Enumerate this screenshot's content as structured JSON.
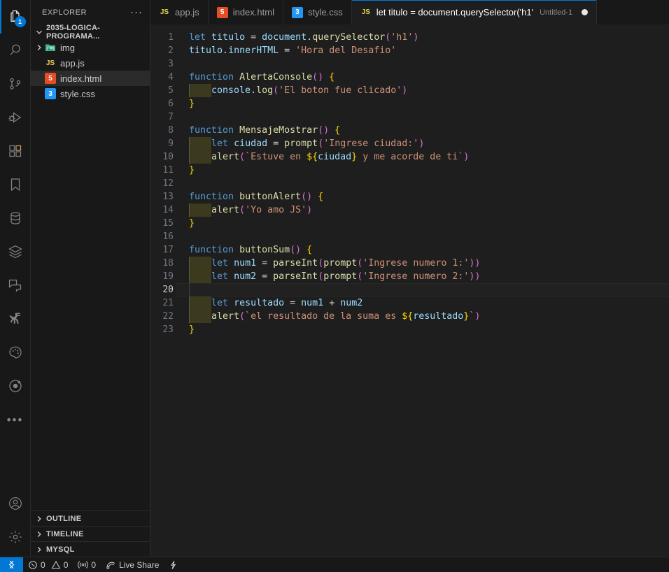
{
  "activitybar": {
    "items": [
      {
        "name": "explorer",
        "icon": "files-icon",
        "badge": "1",
        "active": true
      },
      {
        "name": "search",
        "icon": "search-icon",
        "badge": null,
        "active": false
      },
      {
        "name": "source-control",
        "icon": "source-control-icon",
        "badge": null,
        "active": false
      },
      {
        "name": "run-and-debug",
        "icon": "run-debug-icon",
        "badge": null,
        "active": false
      },
      {
        "name": "extensions",
        "icon": "extensions-icon",
        "badge": null,
        "active": false
      },
      {
        "name": "bookmarks",
        "icon": "bookmark-icon",
        "badge": null,
        "active": false
      },
      {
        "name": "database",
        "icon": "database-icon",
        "badge": null,
        "active": false
      },
      {
        "name": "layers",
        "icon": "layers-icon",
        "badge": null,
        "active": false
      },
      {
        "name": "comments",
        "icon": "comment-icon",
        "badge": null,
        "active": false
      },
      {
        "name": "dinosaur",
        "icon": "dinosaur-icon",
        "badge": null,
        "active": false
      },
      {
        "name": "theme",
        "icon": "palette-icon",
        "badge": null,
        "active": false
      },
      {
        "name": "ionic",
        "icon": "ionic-icon",
        "badge": null,
        "active": false
      }
    ],
    "more_label": "•••",
    "bottom": [
      {
        "name": "accounts",
        "icon": "account-icon"
      },
      {
        "name": "manage",
        "icon": "gear-icon"
      }
    ]
  },
  "sidebar": {
    "title": "EXPLORER",
    "actions_label": "···",
    "root": {
      "label": "2035-LOGICA-PROGRAMA...",
      "expanded": true
    },
    "files": [
      {
        "name": "img",
        "type": "folder",
        "icon": "folder-img-icon",
        "selected": false,
        "expanded": false
      },
      {
        "name": "app.js",
        "type": "file",
        "icon": "js-icon",
        "icon_label": "JS",
        "selected": false
      },
      {
        "name": "index.html",
        "type": "file",
        "icon": "html-icon",
        "icon_label": "5",
        "selected": true
      },
      {
        "name": "style.css",
        "type": "file",
        "icon": "css-icon",
        "icon_label": "3",
        "selected": false
      }
    ],
    "sections": [
      {
        "label": "OUTLINE",
        "expanded": false
      },
      {
        "label": "TIMELINE",
        "expanded": false
      },
      {
        "label": "MYSQL",
        "expanded": false
      }
    ]
  },
  "tabs": [
    {
      "label": "app.js",
      "icon": "js-icon",
      "icon_label": "JS",
      "description": "",
      "active": false,
      "dirty": false
    },
    {
      "label": "index.html",
      "icon": "html-icon",
      "icon_label": "5",
      "description": "",
      "active": false,
      "dirty": false
    },
    {
      "label": "style.css",
      "icon": "css-icon",
      "icon_label": "3",
      "description": "",
      "active": false,
      "dirty": false
    },
    {
      "label": "let titulo = document.querySelector('h1'",
      "icon": "js-icon",
      "icon_label": "JS",
      "description": "Untitled-1",
      "active": true,
      "dirty": true
    }
  ],
  "editor": {
    "current_line": 20,
    "lines": [
      {
        "n": "1",
        "text": "let titulo = document.querySelector('h1')"
      },
      {
        "n": "2",
        "text": "titulo.innerHTML = 'Hora del Desafio'"
      },
      {
        "n": "3",
        "text": ""
      },
      {
        "n": "4",
        "text": "function AlertaConsole() {"
      },
      {
        "n": "5",
        "text": "    console.log('El boton fue clicado')"
      },
      {
        "n": "6",
        "text": "}"
      },
      {
        "n": "7",
        "text": ""
      },
      {
        "n": "8",
        "text": "function MensajeMostrar() {"
      },
      {
        "n": "9",
        "text": "    let ciudad = prompt('Ingrese ciudad:')"
      },
      {
        "n": "10",
        "text": "    alert(`Estuve en ${ciudad} y me acorde de ti`)"
      },
      {
        "n": "11",
        "text": "}"
      },
      {
        "n": "12",
        "text": ""
      },
      {
        "n": "13",
        "text": "function buttonAlert() {"
      },
      {
        "n": "14",
        "text": "    alert('Yo amo JS')"
      },
      {
        "n": "15",
        "text": "}"
      },
      {
        "n": "16",
        "text": ""
      },
      {
        "n": "17",
        "text": "function buttonSum() {"
      },
      {
        "n": "18",
        "text": "    let num1 = parseInt(prompt('Ingrese numero 1:'))"
      },
      {
        "n": "19",
        "text": "    let num2 = parseInt(prompt('Ingrese numero 2:'))"
      },
      {
        "n": "20",
        "text": ""
      },
      {
        "n": "21",
        "text": "    let resultado = num1 + num2"
      },
      {
        "n": "22",
        "text": "    alert(`el resultado de la suma es ${resultado}`)"
      },
      {
        "n": "23",
        "text": "}"
      }
    ]
  },
  "statusbar": {
    "remote_icon": "remote-window-icon",
    "errors": "0",
    "warnings": "0",
    "ports": "0",
    "live_share": "Live Share",
    "extra_icon": "thunder-icon"
  },
  "colors": {
    "accent": "#0078d4",
    "editor_bg": "#1e1e1e",
    "chrome_bg": "#181818",
    "keyword": "#569cd6",
    "variable": "#9cdcfe",
    "function": "#dcdcaa",
    "string": "#ce9178",
    "paren": "#da70d6",
    "brace": "#ffd700"
  }
}
